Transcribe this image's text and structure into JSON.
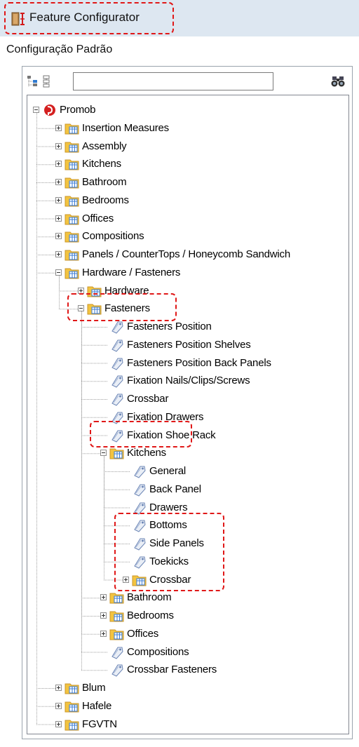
{
  "window": {
    "title": "Feature Configurator",
    "icon": "feature-configurator-icon"
  },
  "subtitle": "Configuração Padrão",
  "toolbar": {
    "collapse_icon": "collapse-tree-icon",
    "expand_icon": "expand-tree-icon",
    "search_value": "",
    "find_icon": "binoculars-icon"
  },
  "tree": [
    {
      "label": "Promob",
      "depth": 0,
      "type": "root",
      "expanded": true,
      "highlighted": false
    },
    {
      "label": "Insertion Measures",
      "depth": 1,
      "type": "folder",
      "expanded": false,
      "highlighted": false
    },
    {
      "label": "Assembly",
      "depth": 1,
      "type": "folder",
      "expanded": false,
      "highlighted": false
    },
    {
      "label": "Kitchens",
      "depth": 1,
      "type": "folder",
      "expanded": false,
      "highlighted": false
    },
    {
      "label": "Bathroom",
      "depth": 1,
      "type": "folder",
      "expanded": false,
      "highlighted": false
    },
    {
      "label": "Bedrooms",
      "depth": 1,
      "type": "folder",
      "expanded": false,
      "highlighted": false
    },
    {
      "label": "Offices",
      "depth": 1,
      "type": "folder",
      "expanded": false,
      "highlighted": false
    },
    {
      "label": "Compositions",
      "depth": 1,
      "type": "folder",
      "expanded": false,
      "highlighted": false
    },
    {
      "label": "Panels / CounterTops / Honeycomb Sandwich",
      "depth": 1,
      "type": "folder",
      "expanded": false,
      "highlighted": false
    },
    {
      "label": "Hardware / Fasteners",
      "depth": 1,
      "type": "folder",
      "expanded": true,
      "highlighted": false
    },
    {
      "label": "Hardware",
      "depth": 2,
      "type": "folder",
      "expanded": false,
      "highlighted": false
    },
    {
      "label": "Fasteners",
      "depth": 2,
      "type": "folder",
      "expanded": true,
      "highlighted": true
    },
    {
      "label": "Fasteners Position",
      "depth": 3,
      "type": "feature",
      "highlighted": false
    },
    {
      "label": "Fasteners Position Shelves",
      "depth": 3,
      "type": "feature",
      "highlighted": false
    },
    {
      "label": "Fasteners Position Back Panels",
      "depth": 3,
      "type": "feature",
      "highlighted": false
    },
    {
      "label": "Fixation Nails/Clips/Screws",
      "depth": 3,
      "type": "feature",
      "highlighted": false
    },
    {
      "label": "Crossbar",
      "depth": 3,
      "type": "feature",
      "highlighted": false
    },
    {
      "label": "Fixation Drawers",
      "depth": 3,
      "type": "feature",
      "highlighted": false
    },
    {
      "label": "Fixation Shoe Rack",
      "depth": 3,
      "type": "feature",
      "highlighted": false
    },
    {
      "label": "Kitchens",
      "depth": 3,
      "type": "folder",
      "expanded": true,
      "highlighted": true
    },
    {
      "label": "General",
      "depth": 4,
      "type": "feature",
      "highlighted": false
    },
    {
      "label": "Back Panel",
      "depth": 4,
      "type": "feature",
      "highlighted": false
    },
    {
      "label": "Drawers",
      "depth": 4,
      "type": "feature",
      "highlighted": false
    },
    {
      "label": "Bottoms",
      "depth": 4,
      "type": "feature",
      "highlighted": true
    },
    {
      "label": "Side Panels",
      "depth": 4,
      "type": "feature",
      "highlighted": true
    },
    {
      "label": "Toekicks",
      "depth": 4,
      "type": "feature",
      "highlighted": true
    },
    {
      "label": "Crossbar",
      "depth": 4,
      "type": "folder",
      "expanded": false,
      "highlighted": true
    },
    {
      "label": "Bathroom",
      "depth": 3,
      "type": "folder",
      "expanded": false,
      "highlighted": false
    },
    {
      "label": "Bedrooms",
      "depth": 3,
      "type": "folder",
      "expanded": false,
      "highlighted": false
    },
    {
      "label": "Offices",
      "depth": 3,
      "type": "folder",
      "expanded": false,
      "highlighted": false
    },
    {
      "label": "Compositions",
      "depth": 3,
      "type": "feature",
      "highlighted": false
    },
    {
      "label": "Crossbar Fasteners",
      "depth": 3,
      "type": "feature",
      "highlighted": false
    },
    {
      "label": "Blum",
      "depth": 1,
      "type": "folder",
      "expanded": false,
      "highlighted": false
    },
    {
      "label": "Hafele",
      "depth": 1,
      "type": "folder",
      "expanded": false,
      "highlighted": false
    },
    {
      "label": "FGVTN",
      "depth": 1,
      "type": "folder",
      "expanded": false,
      "highlighted": false
    }
  ],
  "colors": {
    "titlebar_bg": "#dde7f1",
    "annotation_red": "#e01818",
    "folder_yellow": "#f3c440",
    "tree_line": "#a0a0a0"
  }
}
